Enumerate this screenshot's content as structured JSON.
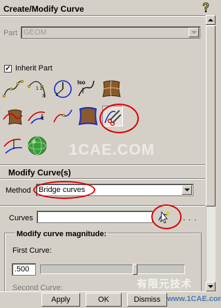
{
  "title": "Create/Modify Curve",
  "part": {
    "label": "Part",
    "value": "GEOM"
  },
  "inherit_part": {
    "label": "Inherit Part",
    "checked": true
  },
  "toolbar_icons": [
    "curve-from-points-icon",
    "arc-from-points-icon",
    "isoparametric-curve-icon",
    "surface-curve-icon",
    "surface-patch-icon",
    "intersection-curve-icon",
    "projected-curve-icon",
    "segmented-curve-icon",
    "surface-boundary-curve-icon",
    "modify-curve-icon",
    "extend-curve-icon",
    "sphere-icon"
  ],
  "modify_group": {
    "title": "Modify Curve(s)",
    "method_label": "Method",
    "method_value": "Bridge curves",
    "curves_label": "Curves",
    "curves_value": "",
    "more_label": ". . .",
    "magnitude_title": "Modify curve magnitude:",
    "first_curve_label": "First Curve:",
    "first_curve_value": ".500",
    "first_curve_slider": 0.5,
    "second_curve_label": "Second Curve:"
  },
  "buttons": {
    "apply": "Apply",
    "ok": "OK",
    "dismiss": "Dismiss"
  },
  "watermarks": {
    "site": "1CAE.COM",
    "brand": "有限元技术",
    "url": "www.1CAE.com"
  },
  "colors": {
    "annotation": "#e00000",
    "panel": "#d4d0c8"
  }
}
